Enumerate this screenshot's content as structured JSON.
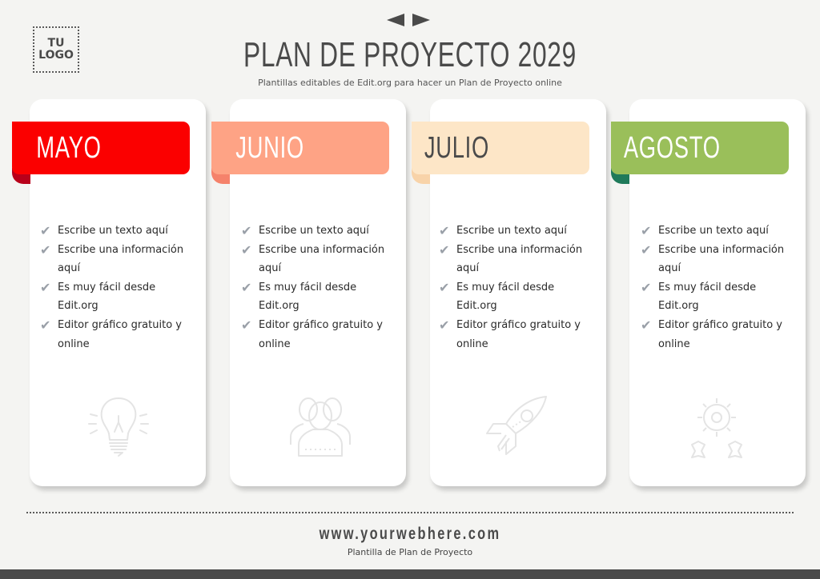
{
  "logo": {
    "line1": "TU",
    "line2": "LOGO"
  },
  "header": {
    "title": "PLAN DE PROYECTO 2029",
    "subtitle": "Plantillas editables de Edit.org para hacer un Plan de Proyecto online",
    "nav_icons": [
      "arrow-left-icon",
      "arrow-right-icon"
    ]
  },
  "colors": {
    "background": "#f4f4f2",
    "mayo": "#fb0000",
    "junio": "#fea385",
    "julio": "#fde6c7",
    "agosto": "#9abf5a",
    "text_dark": "#4a4a4a",
    "check": "#9aa0a8"
  },
  "cards": [
    {
      "month": "MAYO",
      "icon": "lightbulb-icon",
      "items": [
        "Escribe un texto aquí",
        "Escribe una información aquí",
        "Es muy fácil desde Edit.org",
        "Editor gráfico gratuito y online"
      ]
    },
    {
      "month": "JUNIO",
      "icon": "team-icon",
      "items": [
        "Escribe un texto aquí",
        "Escribe una información aquí",
        "Es muy fácil desde Edit.org",
        "Editor gráfico gratuito y online"
      ]
    },
    {
      "month": "JULIO",
      "icon": "rocket-icon",
      "items": [
        "Escribe un texto aquí",
        "Escribe una información aquí",
        "Es muy fácil desde Edit.org",
        "Editor gráfico gratuito y online"
      ]
    },
    {
      "month": "AGOSTO",
      "icon": "gears-icon",
      "items": [
        "Escribe un texto aquí",
        "Escribe una información aquí",
        "Es muy fácil desde Edit.org",
        "Editor gráfico gratuito y online"
      ]
    }
  ],
  "footer": {
    "website": "www.yourwebhere.com",
    "subtitle": "Plantilla de Plan de Proyecto"
  }
}
